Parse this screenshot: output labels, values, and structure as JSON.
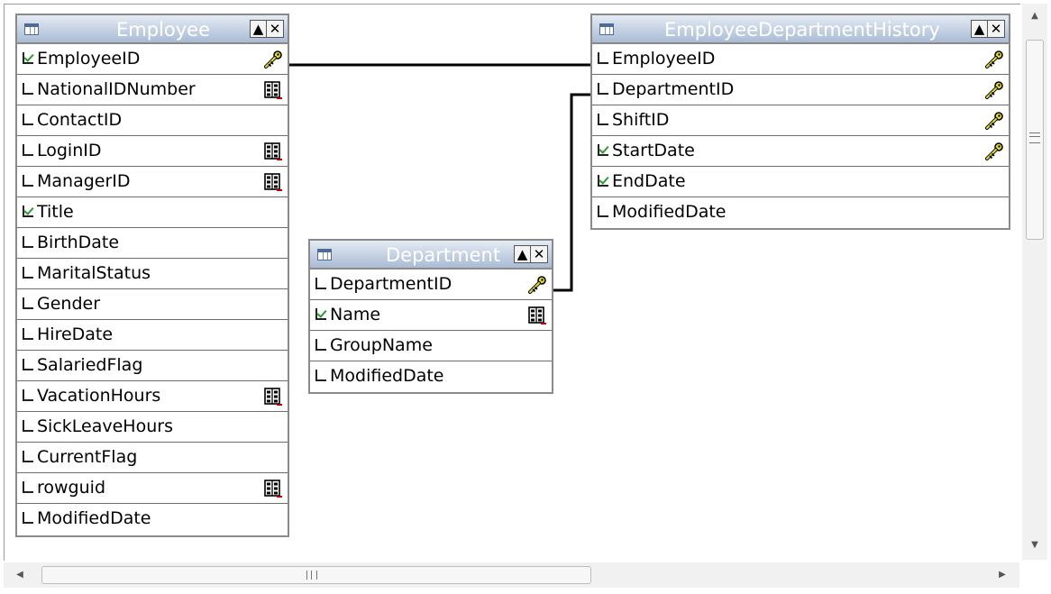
{
  "tables": {
    "employee": {
      "title": "Employee",
      "rows": [
        {
          "label": "EmployeeID",
          "checked": true,
          "icon": "key"
        },
        {
          "label": "NationalIDNumber",
          "checked": false,
          "icon": "index"
        },
        {
          "label": "ContactID",
          "checked": false,
          "icon": ""
        },
        {
          "label": "LoginID",
          "checked": false,
          "icon": "index"
        },
        {
          "label": "ManagerID",
          "checked": false,
          "icon": "index"
        },
        {
          "label": "Title",
          "checked": true,
          "icon": ""
        },
        {
          "label": "BirthDate",
          "checked": false,
          "icon": ""
        },
        {
          "label": "MaritalStatus",
          "checked": false,
          "icon": ""
        },
        {
          "label": "Gender",
          "checked": false,
          "icon": ""
        },
        {
          "label": "HireDate",
          "checked": false,
          "icon": ""
        },
        {
          "label": "SalariedFlag",
          "checked": false,
          "icon": ""
        },
        {
          "label": "VacationHours",
          "checked": false,
          "icon": "index"
        },
        {
          "label": "SickLeaveHours",
          "checked": false,
          "icon": ""
        },
        {
          "label": "CurrentFlag",
          "checked": false,
          "icon": ""
        },
        {
          "label": "rowguid",
          "checked": false,
          "icon": "index"
        },
        {
          "label": "ModifiedDate",
          "checked": false,
          "icon": ""
        }
      ]
    },
    "department": {
      "title": "Department",
      "rows": [
        {
          "label": "DepartmentID",
          "checked": false,
          "icon": "key"
        },
        {
          "label": "Name",
          "checked": true,
          "icon": "index"
        },
        {
          "label": "GroupName",
          "checked": false,
          "icon": ""
        },
        {
          "label": "ModifiedDate",
          "checked": false,
          "icon": ""
        }
      ]
    },
    "history": {
      "title": "EmployeeDepartmentHistory",
      "rows": [
        {
          "label": "EmployeeID",
          "checked": false,
          "icon": "key"
        },
        {
          "label": "DepartmentID",
          "checked": false,
          "icon": "key"
        },
        {
          "label": "ShiftID",
          "checked": false,
          "icon": "key"
        },
        {
          "label": "StartDate",
          "checked": true,
          "icon": "key"
        },
        {
          "label": "EndDate",
          "checked": true,
          "icon": ""
        },
        {
          "label": "ModifiedDate",
          "checked": false,
          "icon": ""
        }
      ]
    }
  },
  "window_buttons": {
    "up": "▲",
    "close": "✕"
  },
  "scrollbar": {
    "up": "▲",
    "down": "▼",
    "left": "◀",
    "right": "▶"
  },
  "colors": {
    "title_bar": "#a9bbd4",
    "check": "#2e9b2e",
    "key": "#e8dc2a"
  }
}
